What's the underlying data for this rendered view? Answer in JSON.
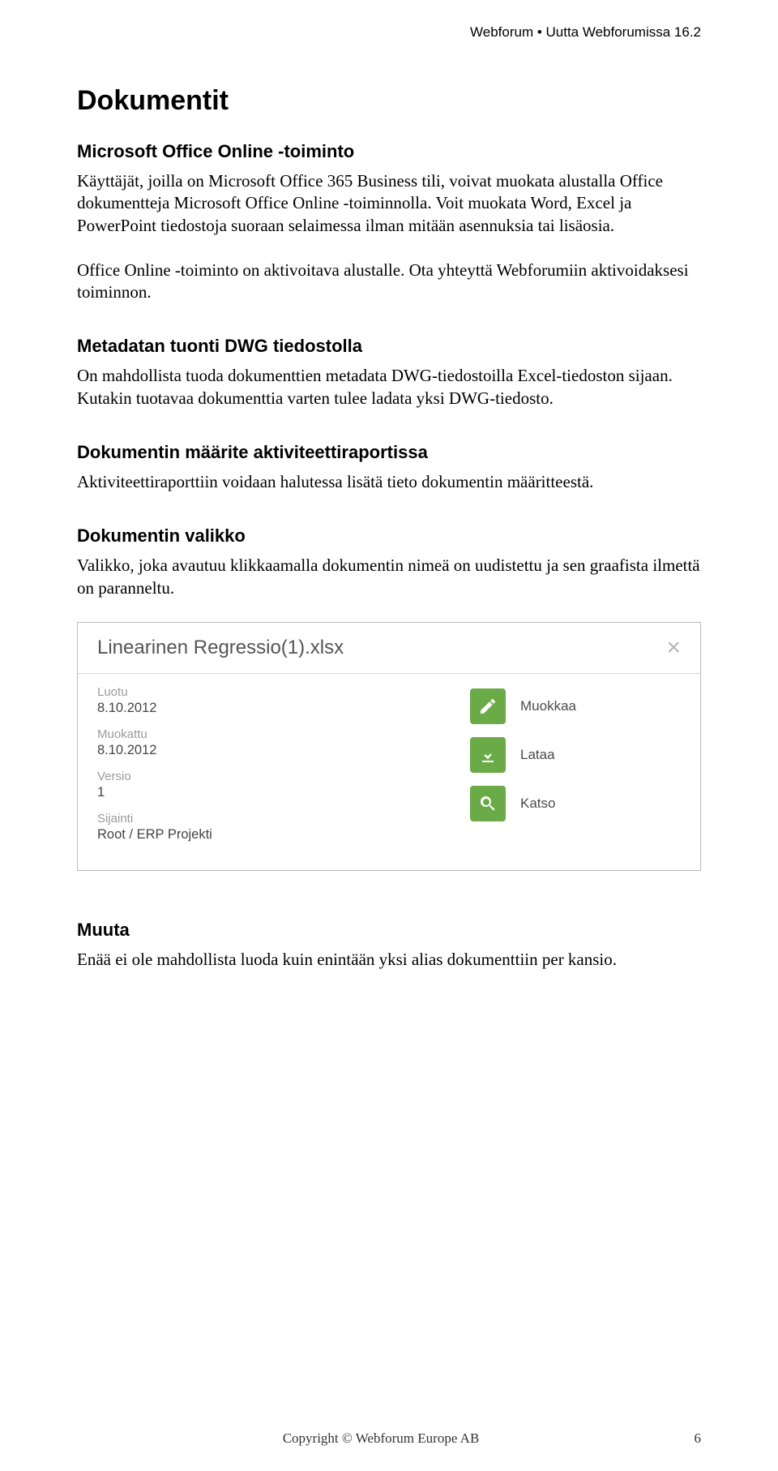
{
  "header": "Webforum • Uutta Webforumissa 16.2",
  "h1": "Dokumentit",
  "s1": {
    "title": "Microsoft Office Online -toiminto",
    "p1": "Käyttäjät, joilla on Microsoft Office 365 Business tili, voivat muokata alustalla Office dokumentteja Microsoft Office Online -toiminnolla. Voit muokata Word, Excel ja PowerPoint tiedostoja suoraan selaimessa ilman mitään asennuksia tai lisäosia.",
    "p2": "Office Online -toiminto on aktivoitava alustalle. Ota yhteyttä Webforumiin aktivoidaksesi toiminnon."
  },
  "s2": {
    "title": "Metadatan tuonti DWG tiedostolla",
    "p": "On mahdollista tuoda dokumenttien metadata DWG-tiedostoilla Excel-tiedoston sijaan. Kutakin tuotavaa dokumenttia varten tulee ladata yksi DWG-tiedosto."
  },
  "s3": {
    "title": "Dokumentin määrite aktiviteettiraportissa",
    "p": "Aktiviteettiraporttiin voidaan halutessa lisätä tieto dokumentin määritteestä."
  },
  "s4": {
    "title": "Dokumentin valikko",
    "p": "Valikko, joka avautuu klikkaamalla dokumentin nimeä on uudistettu ja sen graafista ilmettä on paranneltu."
  },
  "panel": {
    "title": "Linearinen Regressio(1).xlsx",
    "meta": {
      "created_label": "Luotu",
      "created_value": "8.10.2012",
      "modified_label": "Muokattu",
      "modified_value": "8.10.2012",
      "version_label": "Versio",
      "version_value": "1",
      "location_label": "Sijainti",
      "location_value": "Root / ERP Projekti"
    },
    "actions": {
      "edit": "Muokkaa",
      "download": "Lataa",
      "view": "Katso"
    }
  },
  "s5": {
    "title": "Muuta",
    "p": "Enää ei ole mahdollista luoda kuin enintään yksi alias dokumenttiin per kansio."
  },
  "footer": {
    "copyright": "Copyright © Webforum Europe AB",
    "page": "6"
  }
}
